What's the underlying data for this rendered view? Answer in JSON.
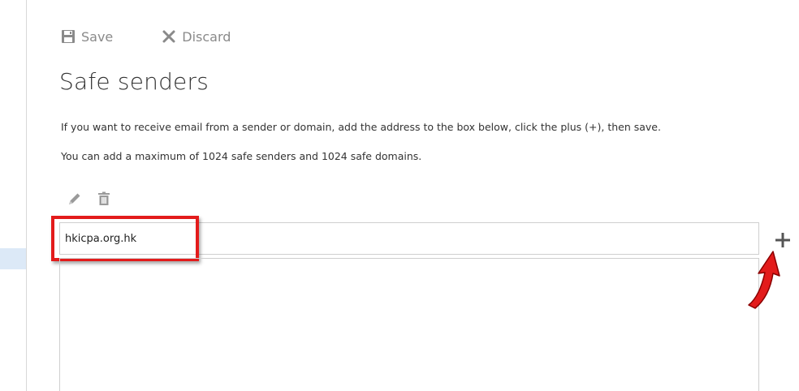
{
  "toolbar": {
    "save_label": "Save",
    "save_icon": "floppy-disk-icon",
    "discard_label": "Discard",
    "discard_icon": "x-icon"
  },
  "title": "Safe senders",
  "description": {
    "line1": "If you want to receive email from a sender or domain, add the address to the box below, click the plus (+), then save.",
    "line2": "You can add a maximum of 1024 safe senders and 1024 safe domains."
  },
  "list_tools": {
    "edit_icon": "pencil-icon",
    "delete_icon": "trash-icon"
  },
  "entry": {
    "value": "hkicpa.org.hk"
  },
  "add_button": {
    "icon": "plus-icon",
    "glyph": "+"
  },
  "list": {
    "items": []
  },
  "colors": {
    "highlight": "#e31b1b",
    "toolbar_text": "#8a8a8a",
    "border": "#cfcfcf"
  }
}
